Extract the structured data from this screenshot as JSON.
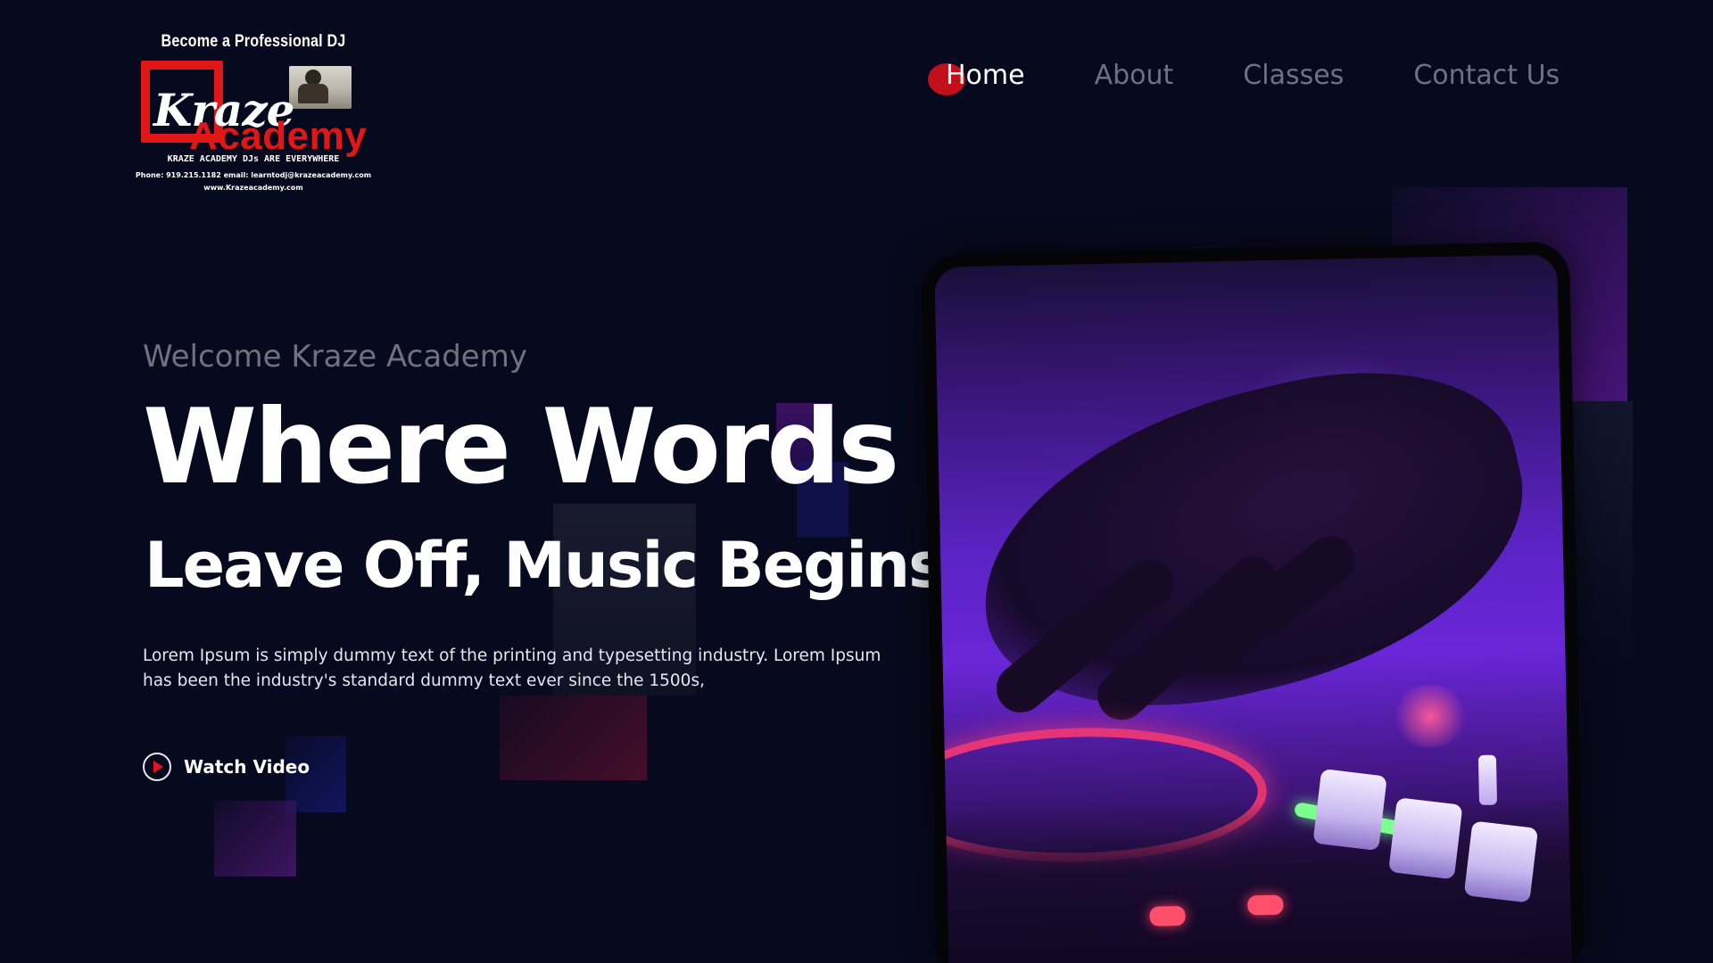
{
  "logo": {
    "tagline_top": "Become a Professional DJ",
    "name_script": "Kraze",
    "name_bold": "Academy",
    "slogan": "KRAZE ACADEMY DJs ARE EVERYWHERE",
    "contact": "Phone: 919.215.1182    email: learntodj@krazeacademy.com",
    "url": "www.Krazeacademy.com",
    "brand_red": "#e11616"
  },
  "nav": {
    "items": [
      {
        "label": "Home",
        "active": true
      },
      {
        "label": "About",
        "active": false
      },
      {
        "label": "Classes",
        "active": false
      },
      {
        "label": "Contact Us",
        "active": false
      }
    ],
    "active_dot_color": "#c0101c"
  },
  "hero": {
    "welcome": "Welcome Kraze Academy",
    "headline_line1": "Where Words",
    "headline_line2": "Leave Off, Music Begins",
    "description": "Lorem Ipsum is simply dummy text of the printing and typesetting industry. Lorem Ipsum has been the industry's standard dummy text ever since the 1500s,",
    "cta_label": "Watch Video",
    "cta_icon": "play-circle-icon"
  },
  "media": {
    "image_subject": "dj-hand-on-mixer-image"
  },
  "colors": {
    "background": "#070a1e",
    "accent_purple": "#6a26d8",
    "accent_red": "#e3141d"
  }
}
